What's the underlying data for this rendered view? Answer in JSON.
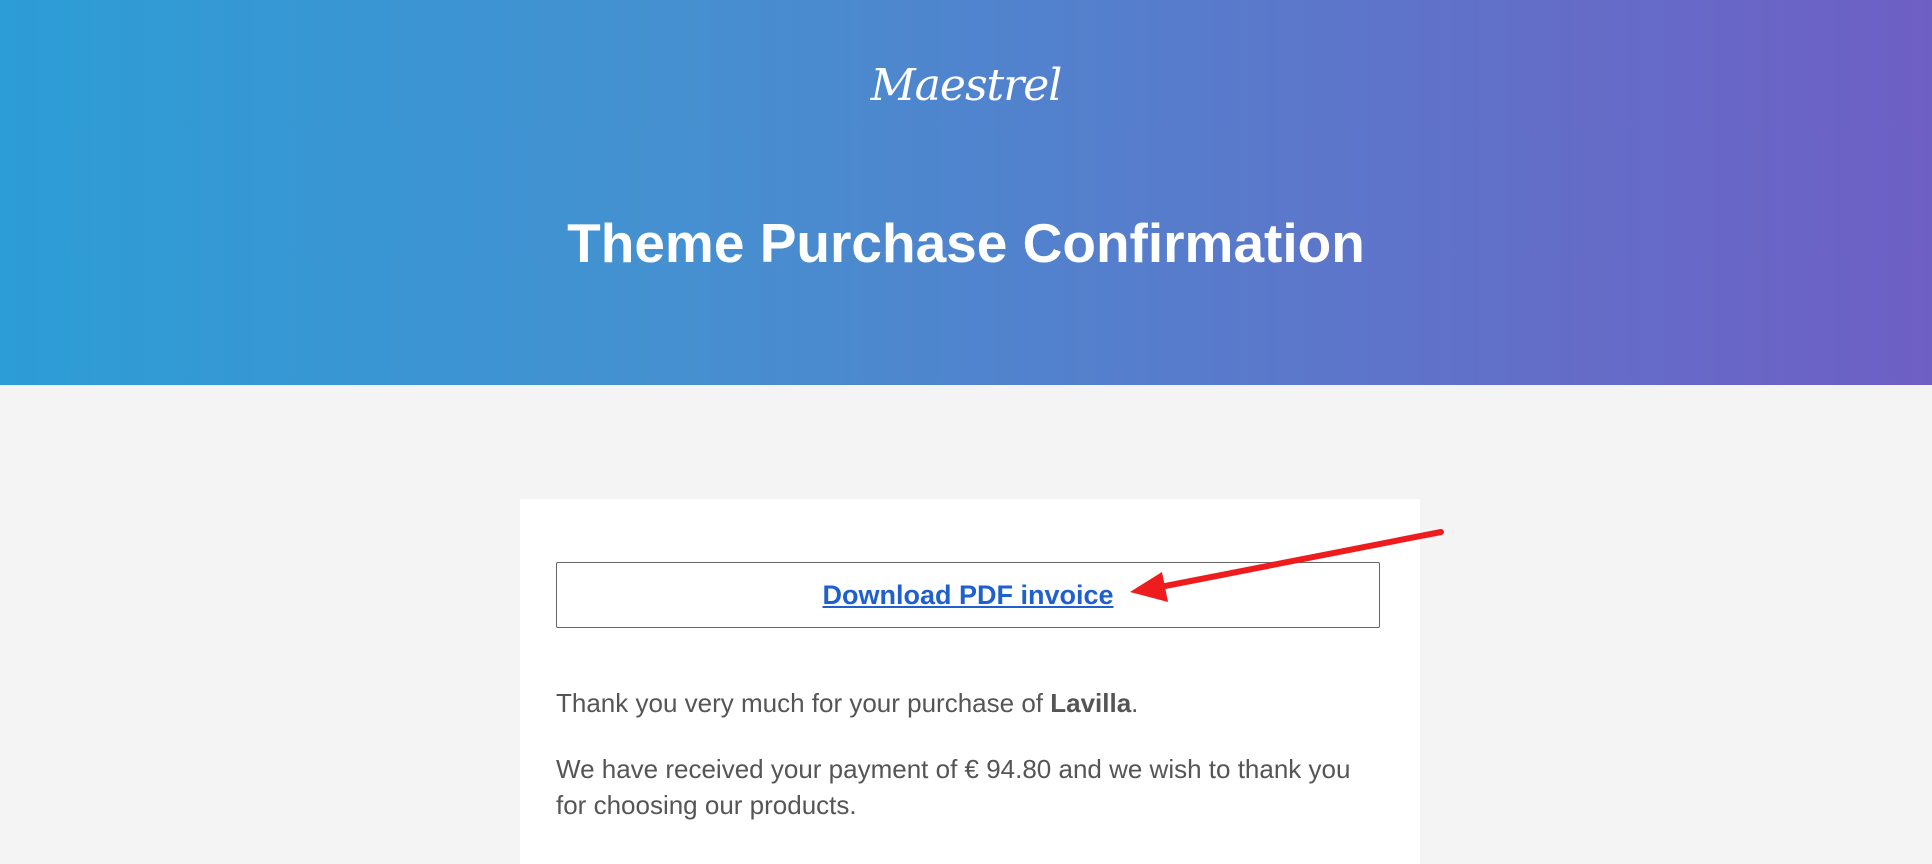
{
  "header": {
    "logo_text": "Maestrel",
    "title": "Theme Purchase Confirmation"
  },
  "card": {
    "invoice_link_label": "Download PDF invoice",
    "thanks_prefix": "Thank you very much for your purchase of ",
    "product_name": "Lavilla",
    "thanks_suffix": ".",
    "payment_message": "We have received your payment of € 94.80 and we wish to thank you for choosing our products."
  },
  "colors": {
    "gradient_start": "#2c9dd6",
    "gradient_end": "#6e5fc5",
    "link": "#1f5fce",
    "annotation_arrow": "#ee1c1c"
  }
}
